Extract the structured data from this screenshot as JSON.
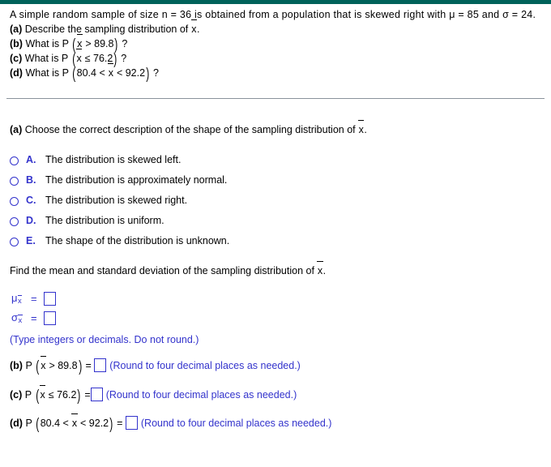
{
  "theme": {
    "accent_bar_color": "#00625a",
    "answer_blue": "#3333cc",
    "divider_color": "#8a939b",
    "text_color": "#000000"
  },
  "question": {
    "intro": {
      "text_before_mu": "A simple random sample of size n = 36 is obtained from a population that is skewed right with ",
      "mu_statement": "μ = 85",
      "conjunction": " and ",
      "sigma_statement": "σ = 24",
      "period": "."
    },
    "parts": [
      {
        "label": "(a)",
        "text_before": "Describe the sampling distribution of ",
        "variable": "x",
        "text_after": ".",
        "has_parens": false
      },
      {
        "label": "(b)",
        "text_before": "What is P ",
        "expr_prefix": "",
        "variable": "x",
        "expr_suffix": " > 89.8",
        "text_after": " ?",
        "has_parens": true
      },
      {
        "label": "(c)",
        "text_before": "What is P ",
        "expr_prefix": "",
        "variable": "x",
        "expr_suffix": " ≤ 76.2",
        "text_after": " ?",
        "has_parens": true
      },
      {
        "label": "(d)",
        "text_before": "What is P ",
        "expr_prefix": "80.4 < ",
        "variable": "x",
        "expr_suffix": " < 92.2",
        "text_after": " ?",
        "has_parens": true
      }
    ]
  },
  "part_a": {
    "label": "(a)",
    "prompt_before": "Choose the correct description of the shape of the sampling distribution of ",
    "prompt_variable": "x",
    "prompt_after": ".",
    "choices": [
      {
        "letter": "A.",
        "text": "The distribution is skewed left."
      },
      {
        "letter": "B.",
        "text": "The distribution is approximately normal."
      },
      {
        "letter": "C.",
        "text": "The distribution is skewed right."
      },
      {
        "letter": "D.",
        "text": "The distribution is uniform."
      },
      {
        "letter": "E.",
        "text": "The shape of the distribution is unknown."
      }
    ],
    "selected": null
  },
  "mean_sd_section": {
    "prompt_before": "Find the mean and standard deviation of the sampling distribution of ",
    "prompt_variable": "x",
    "prompt_after": ".",
    "rows": [
      {
        "symbol": "μ",
        "subscript_variable": "x",
        "equals": "=",
        "value": ""
      },
      {
        "symbol": "σ",
        "subscript_variable": "x",
        "equals": "=",
        "value": ""
      }
    ],
    "hint": "(Type integers or decimals. Do not round.)"
  },
  "answer_parts": [
    {
      "label": "(b)",
      "p_symbol": "P",
      "expr_prefix": "",
      "variable": "x",
      "expr_suffix": " > 89.8",
      "equals": "=",
      "value": "",
      "hint": "(Round to four decimal places as needed.)"
    },
    {
      "label": "(c)",
      "p_symbol": "P",
      "expr_prefix": "",
      "variable": "x",
      "expr_suffix": " ≤ 76.2",
      "equals": "=",
      "value": "",
      "hint": "(Round to four decimal places as needed.)"
    },
    {
      "label": "(d)",
      "p_symbol": "P",
      "expr_prefix": "80.4 < ",
      "variable": "x",
      "expr_suffix": " < 92.2",
      "equals": "=",
      "value": "",
      "hint": "(Round to four decimal places as needed.)"
    }
  ],
  "parens": {
    "open": "(",
    "close": ")"
  }
}
